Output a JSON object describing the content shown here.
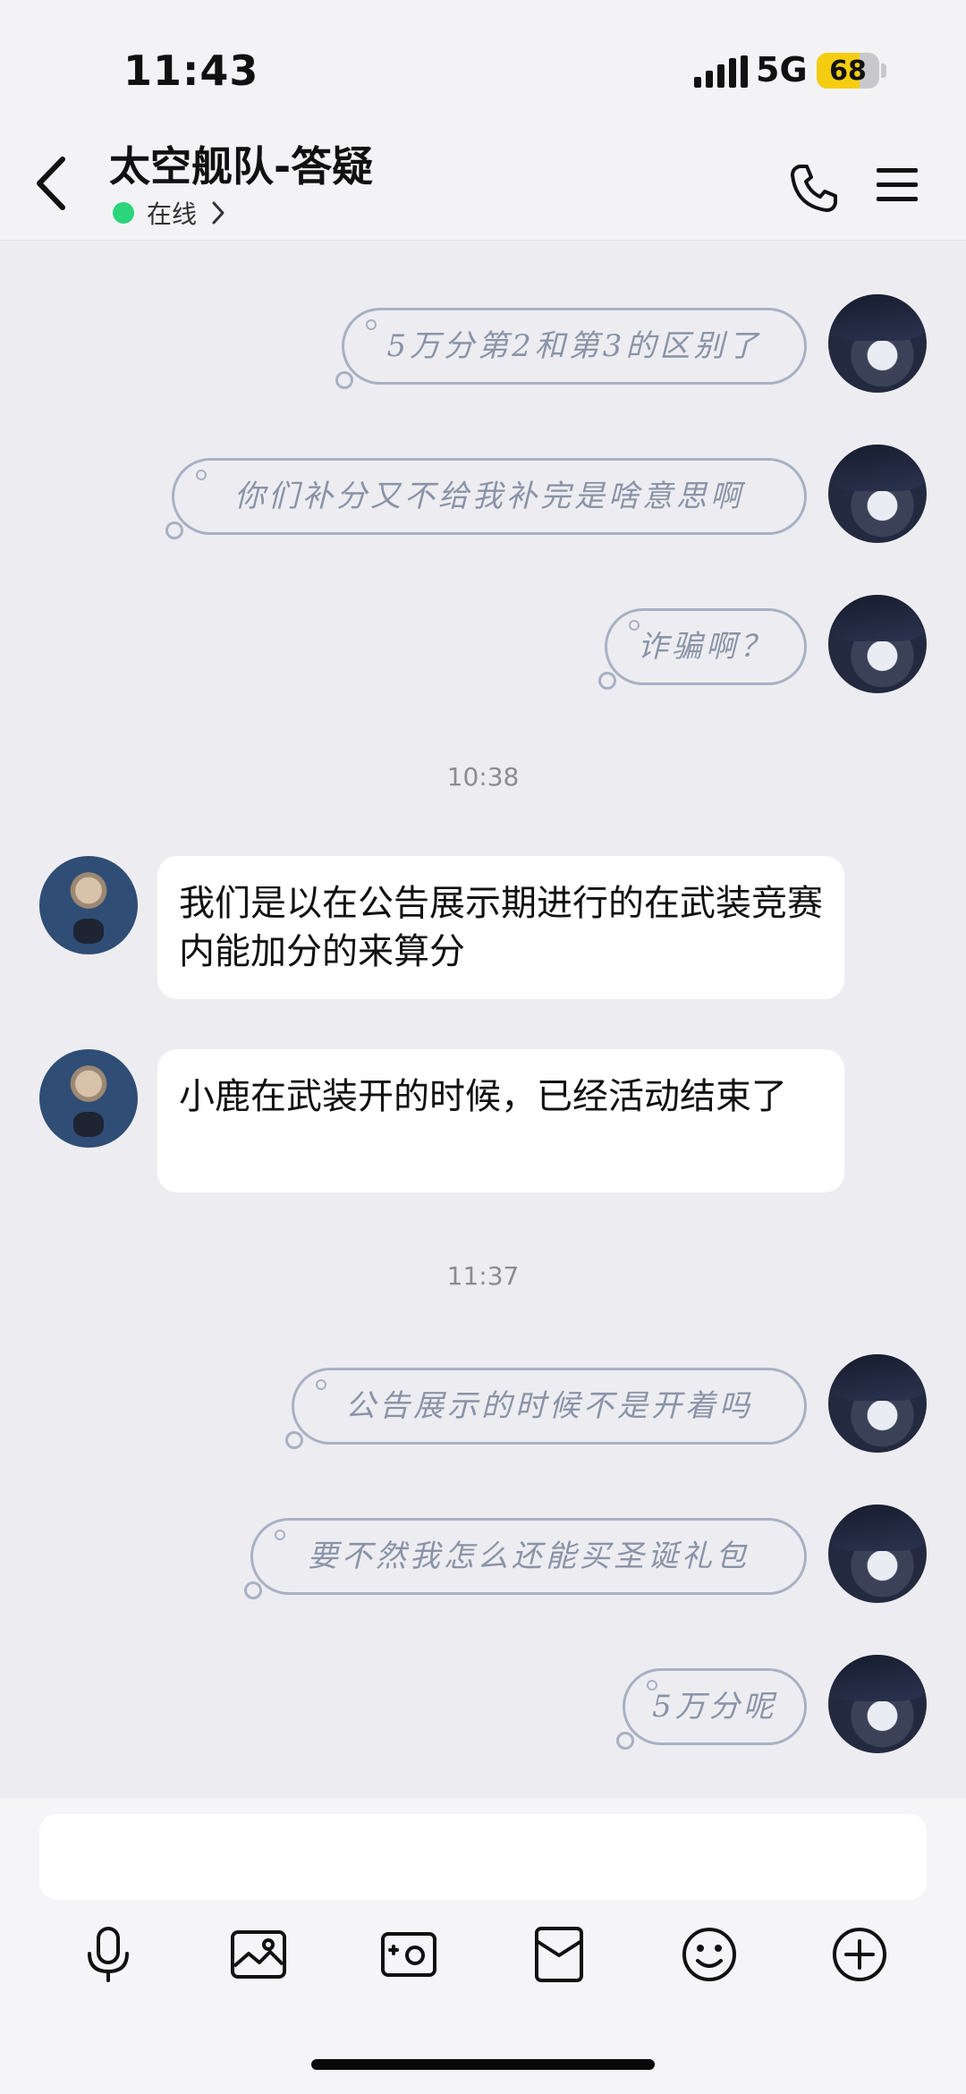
{
  "status_bar": {
    "time": "11:43",
    "network": "5G",
    "battery": "68",
    "battery_level": 0.68
  },
  "header": {
    "title": "太空舰队-答疑",
    "status": "在线"
  },
  "messages": [
    {
      "side": "right",
      "style": "handwritten",
      "text": "5万分第2和第3的区别了"
    },
    {
      "side": "right",
      "style": "handwritten",
      "text": "你们补分又不给我补完是啥意思啊"
    },
    {
      "side": "right",
      "style": "handwritten",
      "text": "诈骗啊？"
    },
    {
      "type": "time",
      "text": "10:38"
    },
    {
      "side": "left",
      "style": "plain",
      "text": "我们是以在公告展示期进行的在武装竞赛内能加分的来算分"
    },
    {
      "side": "left",
      "style": "plain",
      "text": "小鹿在武装开的时候，已经活动结束了"
    },
    {
      "type": "time",
      "text": "11:37"
    },
    {
      "side": "right",
      "style": "handwritten",
      "text": "公告展示的时候不是开着吗"
    },
    {
      "side": "right",
      "style": "handwritten",
      "text": "要不然我怎么还能买圣诞礼包"
    },
    {
      "side": "right",
      "style": "handwritten",
      "text": "5万分呢"
    }
  ],
  "composer": {
    "value": "",
    "placeholder": ""
  },
  "toolbar": [
    "microphone-icon",
    "image-icon",
    "camera-icon",
    "red-packet-icon",
    "emoji-icon",
    "plus-icon"
  ],
  "colors": {
    "background": "#ededf1",
    "online": "#2bd57a",
    "battery": "#f5cd10",
    "hand_bubble_border": "#a9b0c4",
    "hand_bubble_text": "#8a93a8"
  }
}
